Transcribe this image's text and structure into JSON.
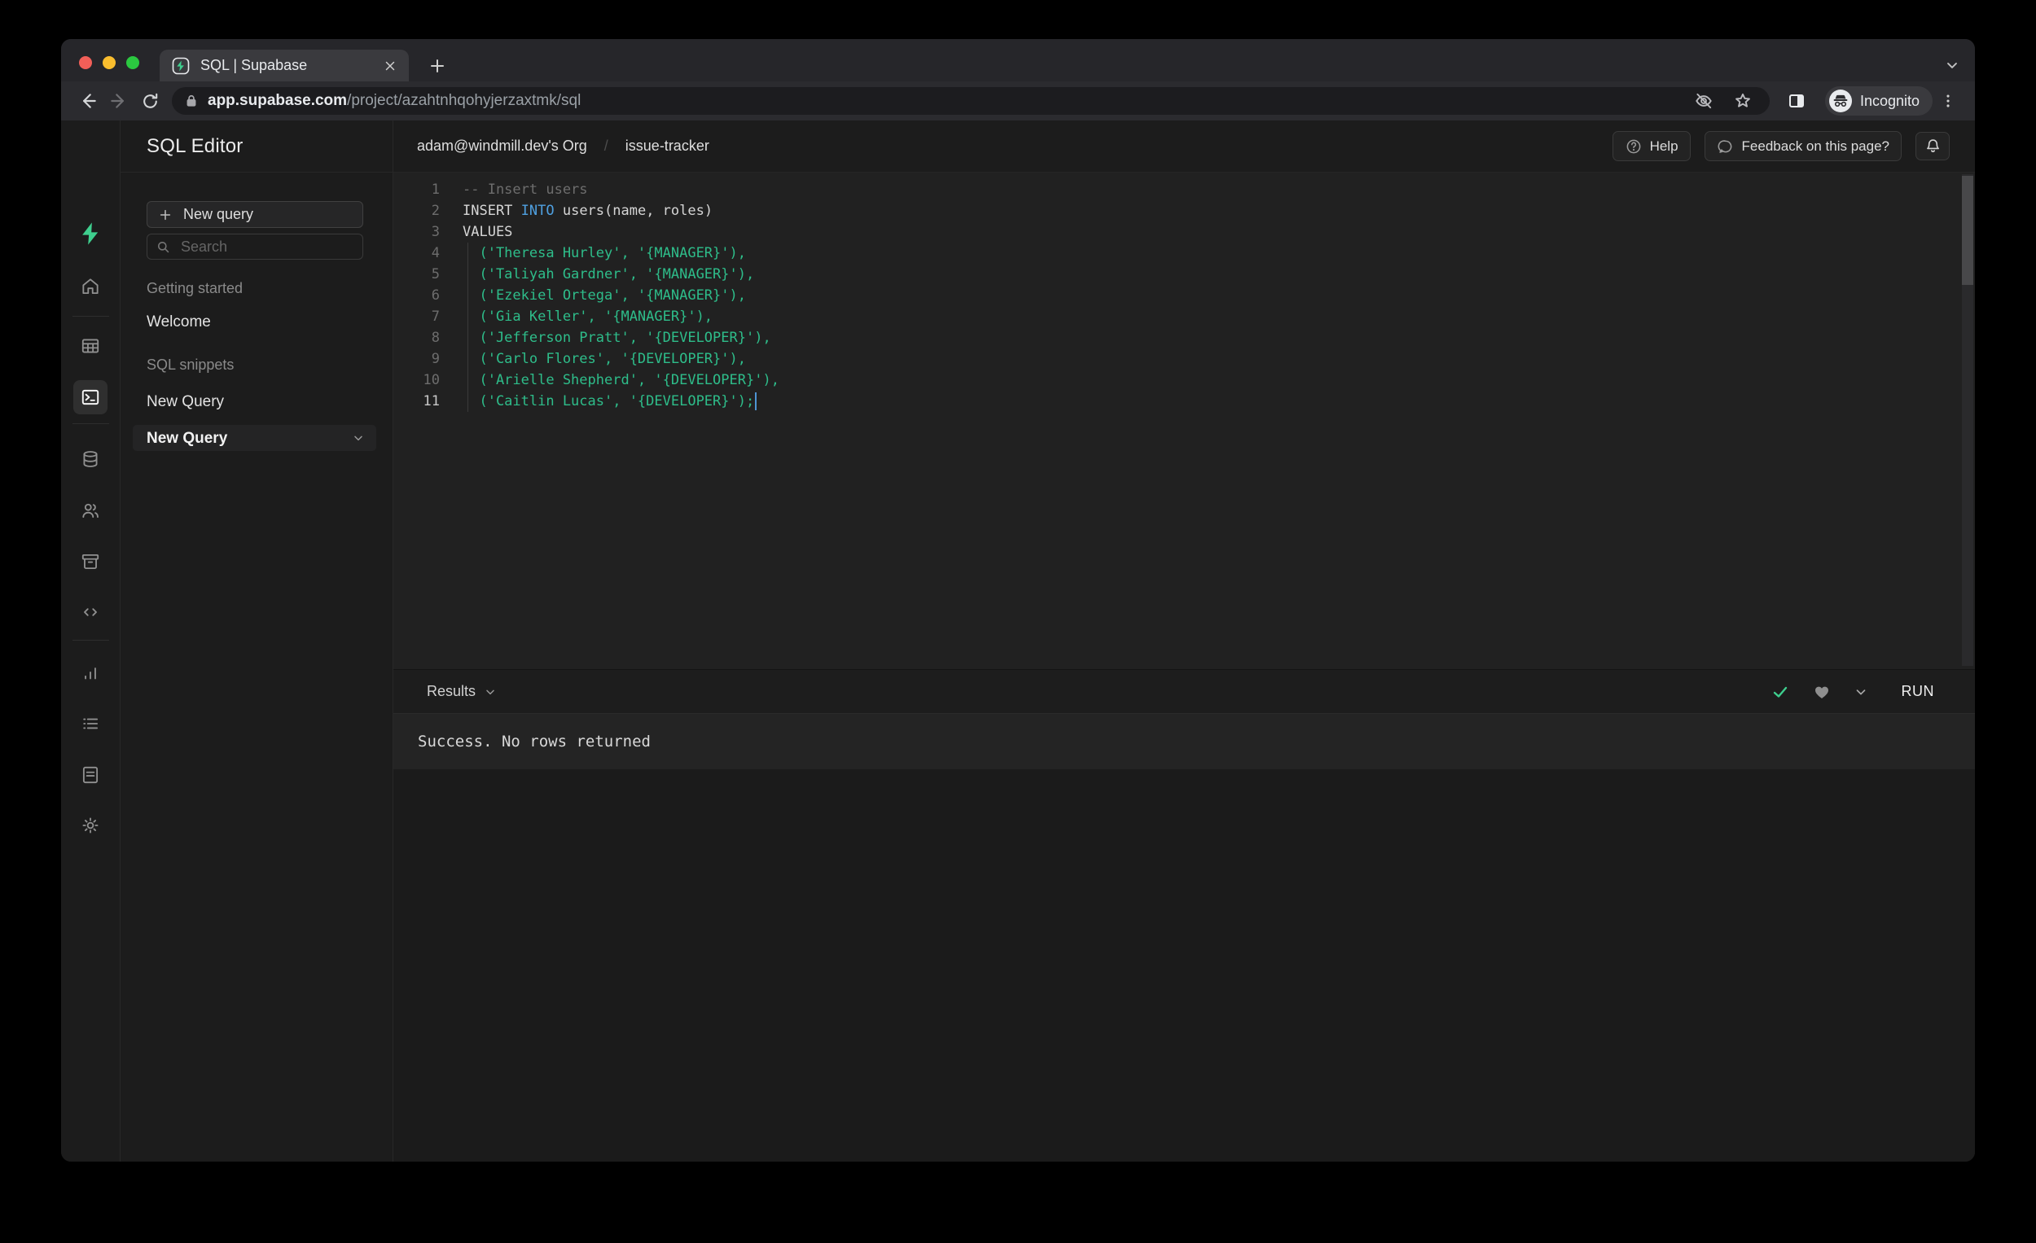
{
  "colors": {
    "accent_green": "#3ecf8e",
    "keyword_blue": "#4fa0e0",
    "string_green": "#2ebd8a"
  },
  "browser": {
    "tab_title": "SQL | Supabase",
    "url": {
      "host": "app.supabase.com",
      "path": "/project/azahtnhqohyjerzaxtmk/sql"
    },
    "incognito_label": "Incognito",
    "icons": [
      "back-icon",
      "forward-icon",
      "reload-icon",
      "lock-icon",
      "eye-off-icon",
      "star-icon",
      "side-panel-icon",
      "incognito-icon",
      "kebab-menu-icon",
      "new-tab-icon",
      "tab-search-icon",
      "close-tab-icon",
      "favicon-supabase"
    ]
  },
  "rail": {
    "items": [
      {
        "type": "logo",
        "name": "supabase-logo"
      },
      {
        "type": "icon",
        "name": "home-icon"
      },
      {
        "type": "divider"
      },
      {
        "type": "icon",
        "name": "table-editor-icon"
      },
      {
        "type": "icon",
        "name": "sql-editor-icon",
        "active": true
      },
      {
        "type": "divider"
      },
      {
        "type": "icon",
        "name": "database-icon"
      },
      {
        "type": "icon",
        "name": "auth-icon"
      },
      {
        "type": "icon",
        "name": "storage-icon"
      },
      {
        "type": "icon",
        "name": "edge-functions-icon"
      },
      {
        "type": "divider"
      },
      {
        "type": "icon",
        "name": "reports-icon"
      },
      {
        "type": "icon",
        "name": "logs-icon"
      },
      {
        "type": "icon",
        "name": "docs-icon"
      },
      {
        "type": "icon",
        "name": "settings-icon"
      }
    ],
    "bottom_item": {
      "type": "icon",
      "name": "account-icon"
    }
  },
  "panel": {
    "title": "SQL Editor",
    "new_query_button": "New query",
    "search_placeholder": "Search",
    "sections": [
      {
        "label": "Getting started",
        "items": [
          {
            "label": "Welcome",
            "active": false
          }
        ]
      },
      {
        "label": "SQL snippets",
        "items": [
          {
            "label": "New Query",
            "active": false
          },
          {
            "label": "New Query",
            "active": true
          }
        ]
      }
    ]
  },
  "header": {
    "breadcrumb": {
      "org": "adam@windmill.dev's Org",
      "separator": "/",
      "project": "issue-tracker"
    },
    "help_label": "Help",
    "feedback_label": "Feedback on this page?",
    "icons": [
      "help-circle-icon",
      "feedback-chat-icon",
      "notifications-bell-icon"
    ]
  },
  "editor": {
    "lines": [
      {
        "num": "1",
        "segments": [
          {
            "type": "comment",
            "text": "-- Insert users"
          }
        ]
      },
      {
        "num": "2",
        "segments": [
          {
            "type": "plain",
            "text": "INSERT "
          },
          {
            "type": "keyword",
            "text": "INTO"
          },
          {
            "type": "plain",
            "text": " users(name, roles)"
          }
        ]
      },
      {
        "num": "3",
        "segments": [
          {
            "type": "plain",
            "text": "VALUES"
          }
        ]
      },
      {
        "num": "4",
        "segments": [
          {
            "type": "string",
            "text": "  ('Theresa Hurley', '{MANAGER}'),"
          }
        ]
      },
      {
        "num": "5",
        "segments": [
          {
            "type": "string",
            "text": "  ('Taliyah Gardner', '{MANAGER}'),"
          }
        ]
      },
      {
        "num": "6",
        "segments": [
          {
            "type": "string",
            "text": "  ('Ezekiel Ortega', '{MANAGER}'),"
          }
        ]
      },
      {
        "num": "7",
        "segments": [
          {
            "type": "string",
            "text": "  ('Gia Keller', '{MANAGER}'),"
          }
        ]
      },
      {
        "num": "8",
        "segments": [
          {
            "type": "string",
            "text": "  ('Jefferson Pratt', '{DEVELOPER}'),"
          }
        ]
      },
      {
        "num": "9",
        "segments": [
          {
            "type": "string",
            "text": "  ('Carlo Flores', '{DEVELOPER}'),"
          }
        ]
      },
      {
        "num": "10",
        "segments": [
          {
            "type": "string",
            "text": "  ('Arielle Shepherd', '{DEVELOPER}'),"
          }
        ]
      },
      {
        "num": "11",
        "cursor": true,
        "segments": [
          {
            "type": "string",
            "text": "  ('Caitlin Lucas', '{DEVELOPER}');"
          }
        ]
      }
    ]
  },
  "results": {
    "label": "Results",
    "run_label": "RUN",
    "message": "Success. No rows returned",
    "icons": [
      "query-success-check-icon",
      "favorite-heart-icon",
      "chevron-down-icon"
    ]
  }
}
